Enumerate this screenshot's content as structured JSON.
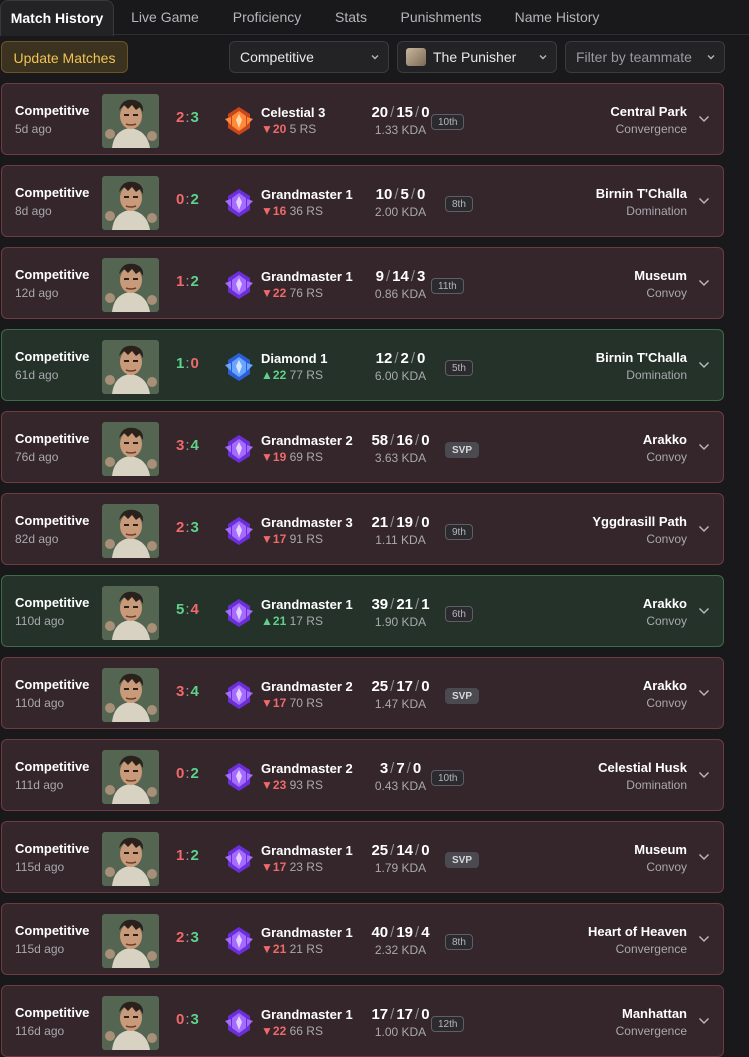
{
  "tabs": [
    "Match History",
    "Live Game",
    "Proficiency",
    "Stats",
    "Punishments",
    "Name History"
  ],
  "toolbar": {
    "update_label": "Update Matches",
    "mode_select": "Competitive",
    "hero_select": "The Punisher",
    "teammate_placeholder": "Filter by teammate"
  },
  "matches": [
    {
      "mode": "Competitive",
      "ago": "5d ago",
      "result": "loss",
      "score_a": "2",
      "score_b": "3",
      "rank": "Celestial 3",
      "rank_tier": "celestial",
      "delta": "20",
      "delta_dir": "down",
      "rs": "5 RS",
      "kills": "20",
      "deaths": "15",
      "assists": "0",
      "kda": "1.33 KDA",
      "badge": "10th",
      "map": "Central Park",
      "map_type": "Convergence"
    },
    {
      "mode": "Competitive",
      "ago": "8d ago",
      "result": "loss",
      "score_a": "0",
      "score_b": "2",
      "rank": "Grandmaster 1",
      "rank_tier": "grandmaster",
      "delta": "16",
      "delta_dir": "down",
      "rs": "36 RS",
      "kills": "10",
      "deaths": "5",
      "assists": "0",
      "kda": "2.00 KDA",
      "badge": "8th",
      "map": "Birnin T'Challa",
      "map_type": "Domination"
    },
    {
      "mode": "Competitive",
      "ago": "12d ago",
      "result": "loss",
      "score_a": "1",
      "score_b": "2",
      "rank": "Grandmaster 1",
      "rank_tier": "grandmaster",
      "delta": "22",
      "delta_dir": "down",
      "rs": "76 RS",
      "kills": "9",
      "deaths": "14",
      "assists": "3",
      "kda": "0.86 KDA",
      "badge": "11th",
      "map": "Museum",
      "map_type": "Convoy"
    },
    {
      "mode": "Competitive",
      "ago": "61d ago",
      "result": "win",
      "score_a": "1",
      "score_b": "0",
      "rank": "Diamond 1",
      "rank_tier": "diamond",
      "delta": "22",
      "delta_dir": "up",
      "rs": "77 RS",
      "kills": "12",
      "deaths": "2",
      "assists": "0",
      "kda": "6.00 KDA",
      "badge": "5th",
      "map": "Birnin T'Challa",
      "map_type": "Domination"
    },
    {
      "mode": "Competitive",
      "ago": "76d ago",
      "result": "loss",
      "score_a": "3",
      "score_b": "4",
      "rank": "Grandmaster 2",
      "rank_tier": "grandmaster",
      "delta": "19",
      "delta_dir": "down",
      "rs": "69 RS",
      "kills": "58",
      "deaths": "16",
      "assists": "0",
      "kda": "3.63 KDA",
      "badge": "SVP",
      "map": "Arakko",
      "map_type": "Convoy"
    },
    {
      "mode": "Competitive",
      "ago": "82d ago",
      "result": "loss",
      "score_a": "2",
      "score_b": "3",
      "rank": "Grandmaster 3",
      "rank_tier": "grandmaster",
      "delta": "17",
      "delta_dir": "down",
      "rs": "91 RS",
      "kills": "21",
      "deaths": "19",
      "assists": "0",
      "kda": "1.11 KDA",
      "badge": "9th",
      "map": "Yggdrasill Path",
      "map_type": "Convoy"
    },
    {
      "mode": "Competitive",
      "ago": "110d ago",
      "result": "win",
      "score_a": "5",
      "score_b": "4",
      "rank": "Grandmaster 1",
      "rank_tier": "grandmaster",
      "delta": "21",
      "delta_dir": "up",
      "rs": "17 RS",
      "kills": "39",
      "deaths": "21",
      "assists": "1",
      "kda": "1.90 KDA",
      "badge": "6th",
      "map": "Arakko",
      "map_type": "Convoy"
    },
    {
      "mode": "Competitive",
      "ago": "110d ago",
      "result": "loss",
      "score_a": "3",
      "score_b": "4",
      "rank": "Grandmaster 2",
      "rank_tier": "grandmaster",
      "delta": "17",
      "delta_dir": "down",
      "rs": "70 RS",
      "kills": "25",
      "deaths": "17",
      "assists": "0",
      "kda": "1.47 KDA",
      "badge": "SVP",
      "map": "Arakko",
      "map_type": "Convoy"
    },
    {
      "mode": "Competitive",
      "ago": "111d ago",
      "result": "loss",
      "score_a": "0",
      "score_b": "2",
      "rank": "Grandmaster 2",
      "rank_tier": "grandmaster",
      "delta": "23",
      "delta_dir": "down",
      "rs": "93 RS",
      "kills": "3",
      "deaths": "7",
      "assists": "0",
      "kda": "0.43 KDA",
      "badge": "10th",
      "map": "Celestial Husk",
      "map_type": "Domination"
    },
    {
      "mode": "Competitive",
      "ago": "115d ago",
      "result": "loss",
      "score_a": "1",
      "score_b": "2",
      "rank": "Grandmaster 1",
      "rank_tier": "grandmaster",
      "delta": "17",
      "delta_dir": "down",
      "rs": "23 RS",
      "kills": "25",
      "deaths": "14",
      "assists": "0",
      "kda": "1.79 KDA",
      "badge": "SVP",
      "map": "Museum",
      "map_type": "Convoy"
    },
    {
      "mode": "Competitive",
      "ago": "115d ago",
      "result": "loss",
      "score_a": "2",
      "score_b": "3",
      "rank": "Grandmaster 1",
      "rank_tier": "grandmaster",
      "delta": "21",
      "delta_dir": "down",
      "rs": "21 RS",
      "kills": "40",
      "deaths": "19",
      "assists": "4",
      "kda": "2.32 KDA",
      "badge": "8th",
      "map": "Heart of Heaven",
      "map_type": "Convergence"
    },
    {
      "mode": "Competitive",
      "ago": "116d ago",
      "result": "loss",
      "score_a": "0",
      "score_b": "3",
      "rank": "Grandmaster 1",
      "rank_tier": "grandmaster",
      "delta": "22",
      "delta_dir": "down",
      "rs": "66 RS",
      "kills": "17",
      "deaths": "17",
      "assists": "0",
      "kda": "1.00 KDA",
      "badge": "12th",
      "map": "Manhattan",
      "map_type": "Convergence"
    }
  ]
}
